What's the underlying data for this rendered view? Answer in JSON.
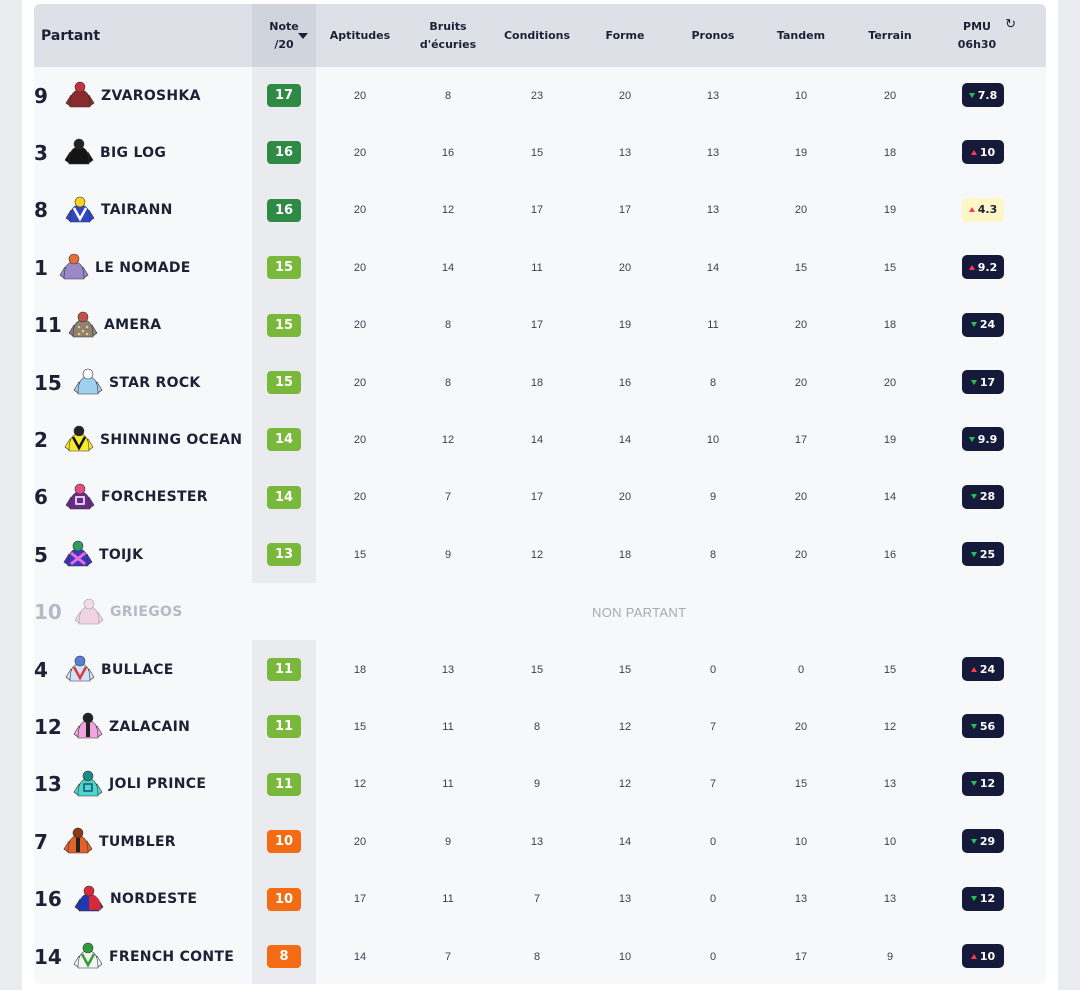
{
  "headers": {
    "partant": "Partant",
    "note_line1": "Note",
    "note_line2": "/20",
    "aptitudes": "Aptitudes",
    "bruits_line1": "Bruits",
    "bruits_line2": "d'écuries",
    "conditions": "Conditions",
    "forme": "Forme",
    "pronos": "Pronos",
    "tandem": "Tandem",
    "terrain": "Terrain",
    "pmu_line1": "PMU",
    "pmu_line2": "06h30",
    "refresh_icon": "↻"
  },
  "colors": {
    "note_dark_green": "#2f8a45",
    "note_light_green": "#79b83a",
    "note_orange": "#f36c13",
    "pmu_dark": "#151a3a",
    "pmu_highlight": "#fff6c8",
    "arrow_up": "#ff3b4e",
    "arrow_down": "#22c15a"
  },
  "non_partant_label": "NON PARTANT",
  "runners": [
    {
      "num": "9",
      "name": "ZVAROSHKA",
      "note": "17",
      "level": "dark",
      "aptitudes": "20",
      "bruits": "8",
      "conditions": "23",
      "forme": "20",
      "pronos": "13",
      "tandem": "10",
      "terrain": "20",
      "pmu": "7.8",
      "trend": "down",
      "highlight": false,
      "silk": "silk-maroon"
    },
    {
      "num": "3",
      "name": "BIG LOG",
      "note": "16",
      "level": "dark",
      "aptitudes": "20",
      "bruits": "16",
      "conditions": "15",
      "forme": "13",
      "pronos": "13",
      "tandem": "19",
      "terrain": "18",
      "pmu": "10",
      "trend": "up",
      "highlight": false,
      "silk": "silk-black"
    },
    {
      "num": "8",
      "name": "TAIRANN",
      "note": "16",
      "level": "dark",
      "aptitudes": "20",
      "bruits": "12",
      "conditions": "17",
      "forme": "17",
      "pronos": "13",
      "tandem": "20",
      "terrain": "19",
      "pmu": "4.3",
      "trend": "up",
      "highlight": true,
      "silk": "silk-blue-v"
    },
    {
      "num": "1",
      "name": "LE NOMADE",
      "note": "15",
      "level": "light",
      "aptitudes": "20",
      "bruits": "14",
      "conditions": "11",
      "forme": "20",
      "pronos": "14",
      "tandem": "15",
      "terrain": "15",
      "pmu": "9.2",
      "trend": "up",
      "highlight": false,
      "silk": "silk-lavender"
    },
    {
      "num": "11",
      "name": "AMERA",
      "note": "15",
      "level": "light",
      "aptitudes": "20",
      "bruits": "8",
      "conditions": "17",
      "forme": "19",
      "pronos": "11",
      "tandem": "20",
      "terrain": "18",
      "pmu": "24",
      "trend": "down",
      "highlight": false,
      "silk": "silk-grey"
    },
    {
      "num": "15",
      "name": "STAR ROCK",
      "note": "15",
      "level": "light",
      "aptitudes": "20",
      "bruits": "8",
      "conditions": "18",
      "forme": "16",
      "pronos": "8",
      "tandem": "20",
      "terrain": "20",
      "pmu": "17",
      "trend": "down",
      "highlight": false,
      "silk": "silk-lightblue"
    },
    {
      "num": "2",
      "name": "SHINNING OCEAN",
      "note": "14",
      "level": "light",
      "aptitudes": "20",
      "bruits": "12",
      "conditions": "14",
      "forme": "14",
      "pronos": "10",
      "tandem": "17",
      "terrain": "19",
      "pmu": "9.9",
      "trend": "down",
      "highlight": false,
      "silk": "silk-yellow-v"
    },
    {
      "num": "6",
      "name": "FORCHESTER",
      "note": "14",
      "level": "light",
      "aptitudes": "20",
      "bruits": "7",
      "conditions": "17",
      "forme": "20",
      "pronos": "9",
      "tandem": "20",
      "terrain": "14",
      "pmu": "28",
      "trend": "down",
      "highlight": false,
      "silk": "silk-purple"
    },
    {
      "num": "5",
      "name": "TOIJK",
      "note": "13",
      "level": "light",
      "aptitudes": "15",
      "bruits": "9",
      "conditions": "12",
      "forme": "18",
      "pronos": "8",
      "tandem": "20",
      "terrain": "16",
      "pmu": "25",
      "trend": "down",
      "highlight": false,
      "silk": "silk-blue-cross"
    },
    {
      "num": "10",
      "name": "GRIEGOS",
      "non_partant": true,
      "silk": "silk-pink"
    },
    {
      "num": "4",
      "name": "BULLACE",
      "note": "11",
      "level": "light",
      "aptitudes": "18",
      "bruits": "13",
      "conditions": "15",
      "forme": "15",
      "pronos": "0",
      "tandem": "0",
      "terrain": "15",
      "pmu": "24",
      "trend": "up",
      "highlight": false,
      "silk": "silk-white-red"
    },
    {
      "num": "12",
      "name": "ZALACAIN",
      "note": "11",
      "level": "light",
      "aptitudes": "15",
      "bruits": "11",
      "conditions": "8",
      "forme": "12",
      "pronos": "7",
      "tandem": "20",
      "terrain": "12",
      "pmu": "56",
      "trend": "down",
      "highlight": false,
      "silk": "silk-pink-black"
    },
    {
      "num": "13",
      "name": "JOLI PRINCE",
      "note": "11",
      "level": "light",
      "aptitudes": "12",
      "bruits": "11",
      "conditions": "9",
      "forme": "12",
      "pronos": "7",
      "tandem": "15",
      "terrain": "13",
      "pmu": "12",
      "trend": "down",
      "highlight": false,
      "silk": "silk-cyan"
    },
    {
      "num": "7",
      "name": "TUMBLER",
      "note": "10",
      "level": "orange",
      "aptitudes": "20",
      "bruits": "9",
      "conditions": "13",
      "forme": "14",
      "pronos": "0",
      "tandem": "10",
      "terrain": "10",
      "pmu": "29",
      "trend": "down",
      "highlight": false,
      "silk": "silk-orange-black"
    },
    {
      "num": "16",
      "name": "NORDESTE",
      "note": "10",
      "level": "orange",
      "aptitudes": "17",
      "bruits": "11",
      "conditions": "7",
      "forme": "13",
      "pronos": "0",
      "tandem": "13",
      "terrain": "13",
      "pmu": "12",
      "trend": "down",
      "highlight": false,
      "silk": "silk-red-blue"
    },
    {
      "num": "14",
      "name": "FRENCH CONTE",
      "note": "8",
      "level": "orange",
      "aptitudes": "14",
      "bruits": "7",
      "conditions": "8",
      "forme": "10",
      "pronos": "0",
      "tandem": "17",
      "terrain": "9",
      "pmu": "10",
      "trend": "up",
      "highlight": false,
      "silk": "silk-white-green"
    }
  ]
}
